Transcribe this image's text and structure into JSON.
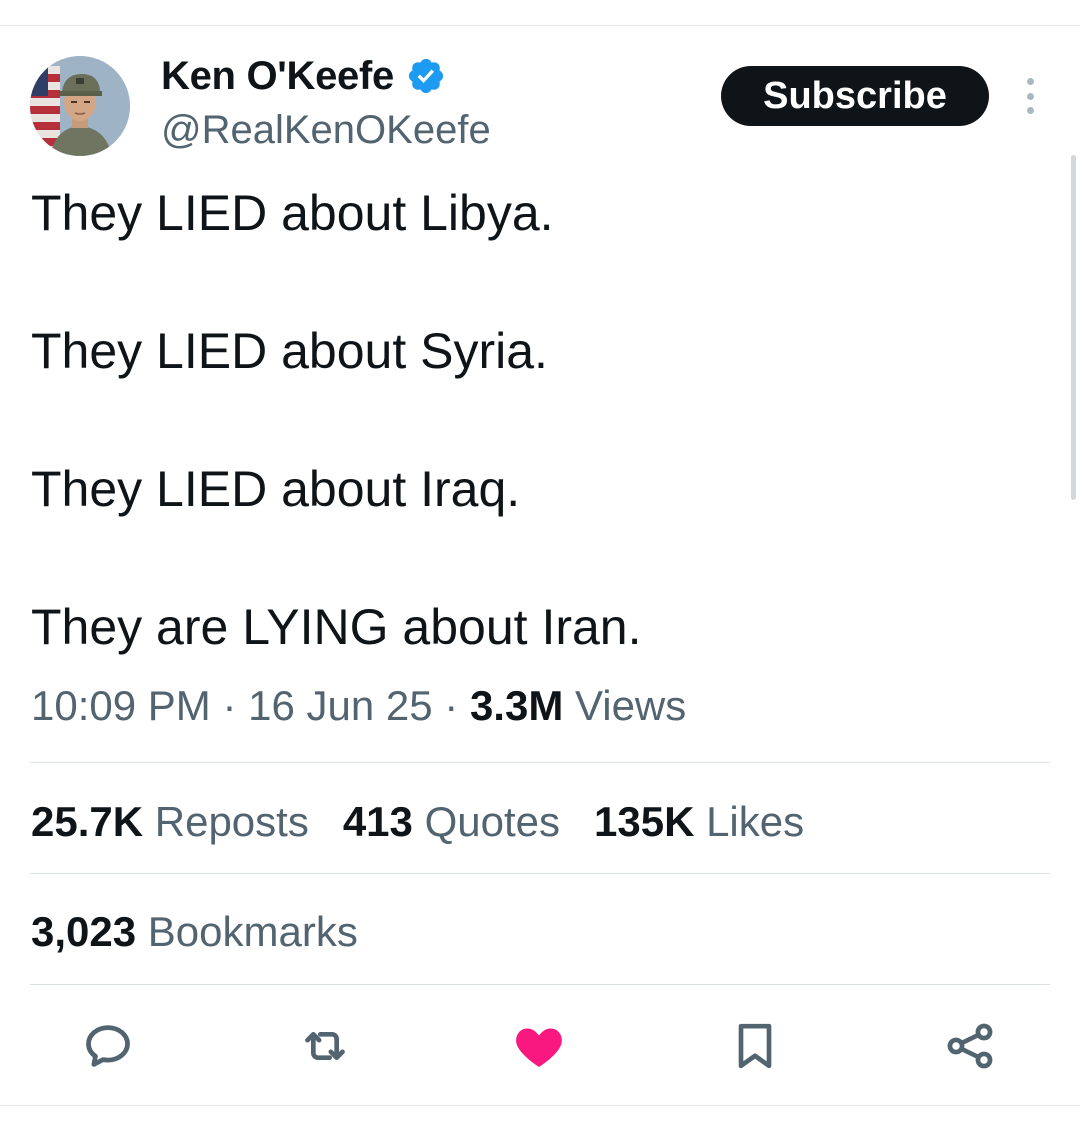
{
  "author": {
    "display_name": "Ken O'Keefe",
    "handle": "@RealKenOKeefe",
    "verified": true,
    "verified_color": "#1d9bf0",
    "avatar_icon": "soldier-portrait-avatar"
  },
  "header": {
    "subscribe_label": "Subscribe",
    "more_icon": "more-options-icon"
  },
  "tweet": {
    "lines": [
      "They LIED about Libya.",
      "They LIED about Syria.",
      "They LIED about Iraq.",
      "They are LYING about Iran."
    ]
  },
  "meta": {
    "time": "10:09 PM",
    "separator": " · ",
    "date": "16 Jun 25",
    "views_count": "3.3M",
    "views_label": "Views"
  },
  "stats": {
    "reposts_count": "25.7K",
    "reposts_label": "Reposts",
    "quotes_count": "413",
    "quotes_label": "Quotes",
    "likes_count": "135K",
    "likes_label": "Likes",
    "bookmarks_count": "3,023",
    "bookmarks_label": "Bookmarks"
  },
  "actions": {
    "icons": [
      "reply-icon",
      "repost-icon",
      "like-icon",
      "bookmark-icon",
      "share-icon"
    ],
    "like_active": true,
    "like_color": "#f91880",
    "icon_color": "#536471"
  }
}
